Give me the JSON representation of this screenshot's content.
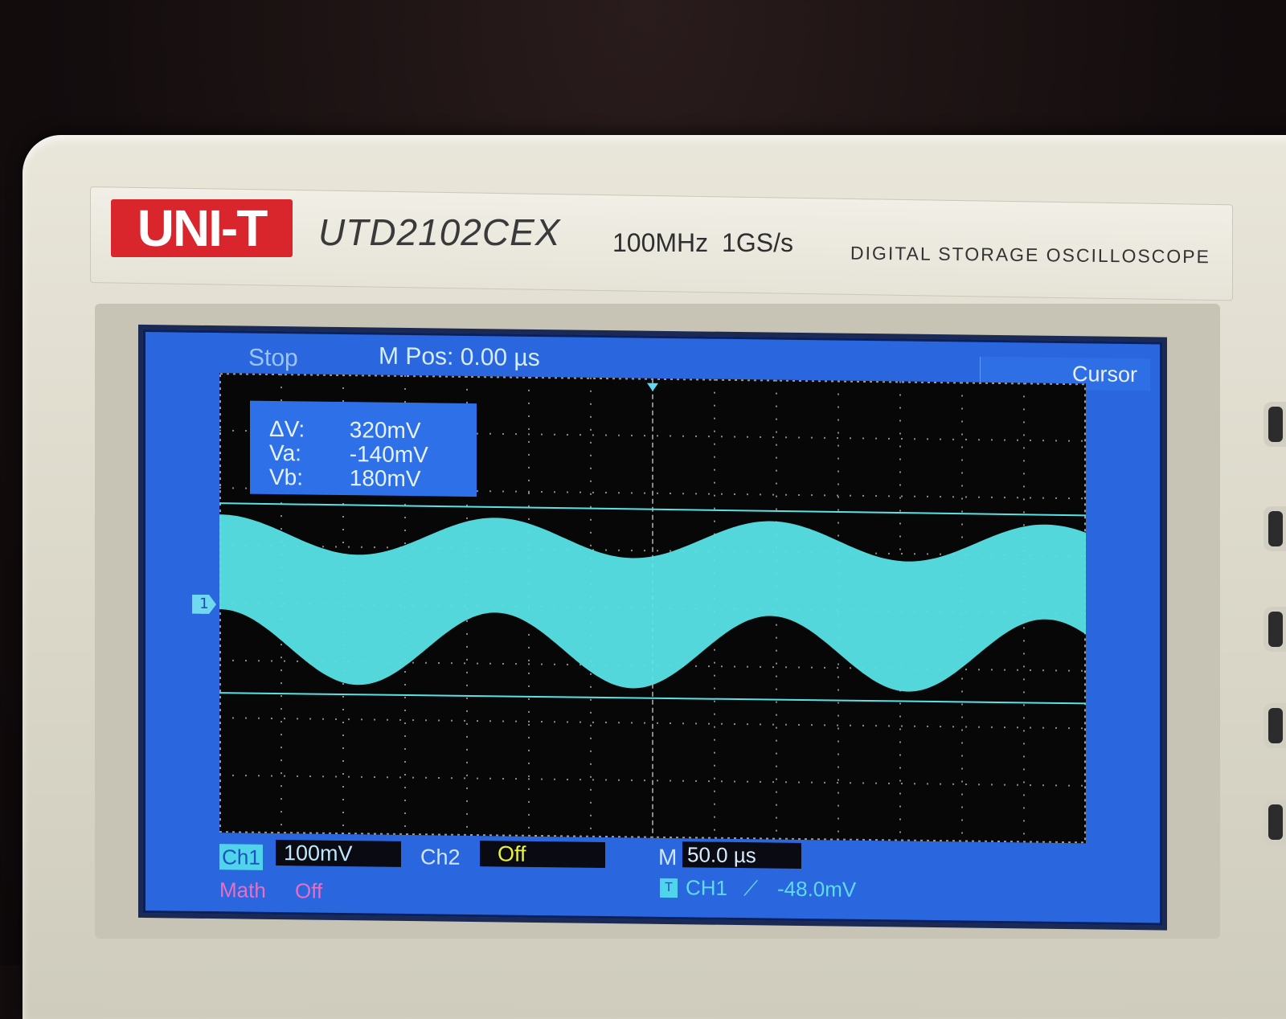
{
  "device": {
    "brand": "UNI-T",
    "model": "UTD2102CEX",
    "specs": "100MHz  1GS/s",
    "type": "DIGITAL STORAGE OSCILLOSCOPE"
  },
  "screen": {
    "status": "Stop",
    "mpos": "M Pos: 0.00 µs",
    "menu_button": "Cursor",
    "cursor_readout": {
      "delta_label": "ΔV:",
      "delta_value": "320mV",
      "va_label": "Va:",
      "va_value": "-140mV",
      "vb_label": "Vb:",
      "vb_value": "180mV"
    },
    "channel_marker": "1",
    "ch1": {
      "label": "Ch1",
      "scale": "100mV"
    },
    "ch2": {
      "label": "Ch2",
      "scale": "Off"
    },
    "timebase": {
      "label": "M",
      "value": "50.0 µs"
    },
    "math": {
      "label": "Math",
      "value": "Off"
    },
    "trigger": {
      "icon": "T",
      "source": "CH1",
      "slope": "⟋",
      "level": "-48.0mV"
    },
    "colors": {
      "trace": "#57e3e6",
      "background": "#2a67de",
      "ch2_value": "#e8f23c",
      "math": "#e86ec4"
    }
  }
}
